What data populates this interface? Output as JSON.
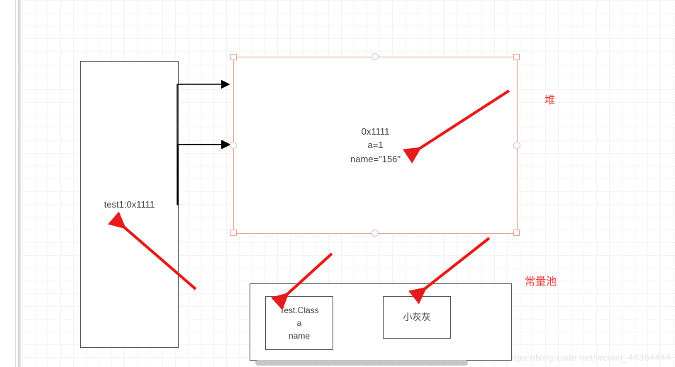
{
  "stackBox": {
    "text": "test1:0x1111"
  },
  "heapBox": {
    "lines": [
      "0x1111",
      "a=1",
      "name=\"156\""
    ]
  },
  "poolBoxA": {
    "lines": [
      "Test.Class",
      "a",
      "name"
    ]
  },
  "poolBoxB": {
    "text": "小灰灰"
  },
  "labels": {
    "heap": "堆",
    "pool": "常量池"
  },
  "watermark": "https://blog.csdn.net/weixin_44364444"
}
